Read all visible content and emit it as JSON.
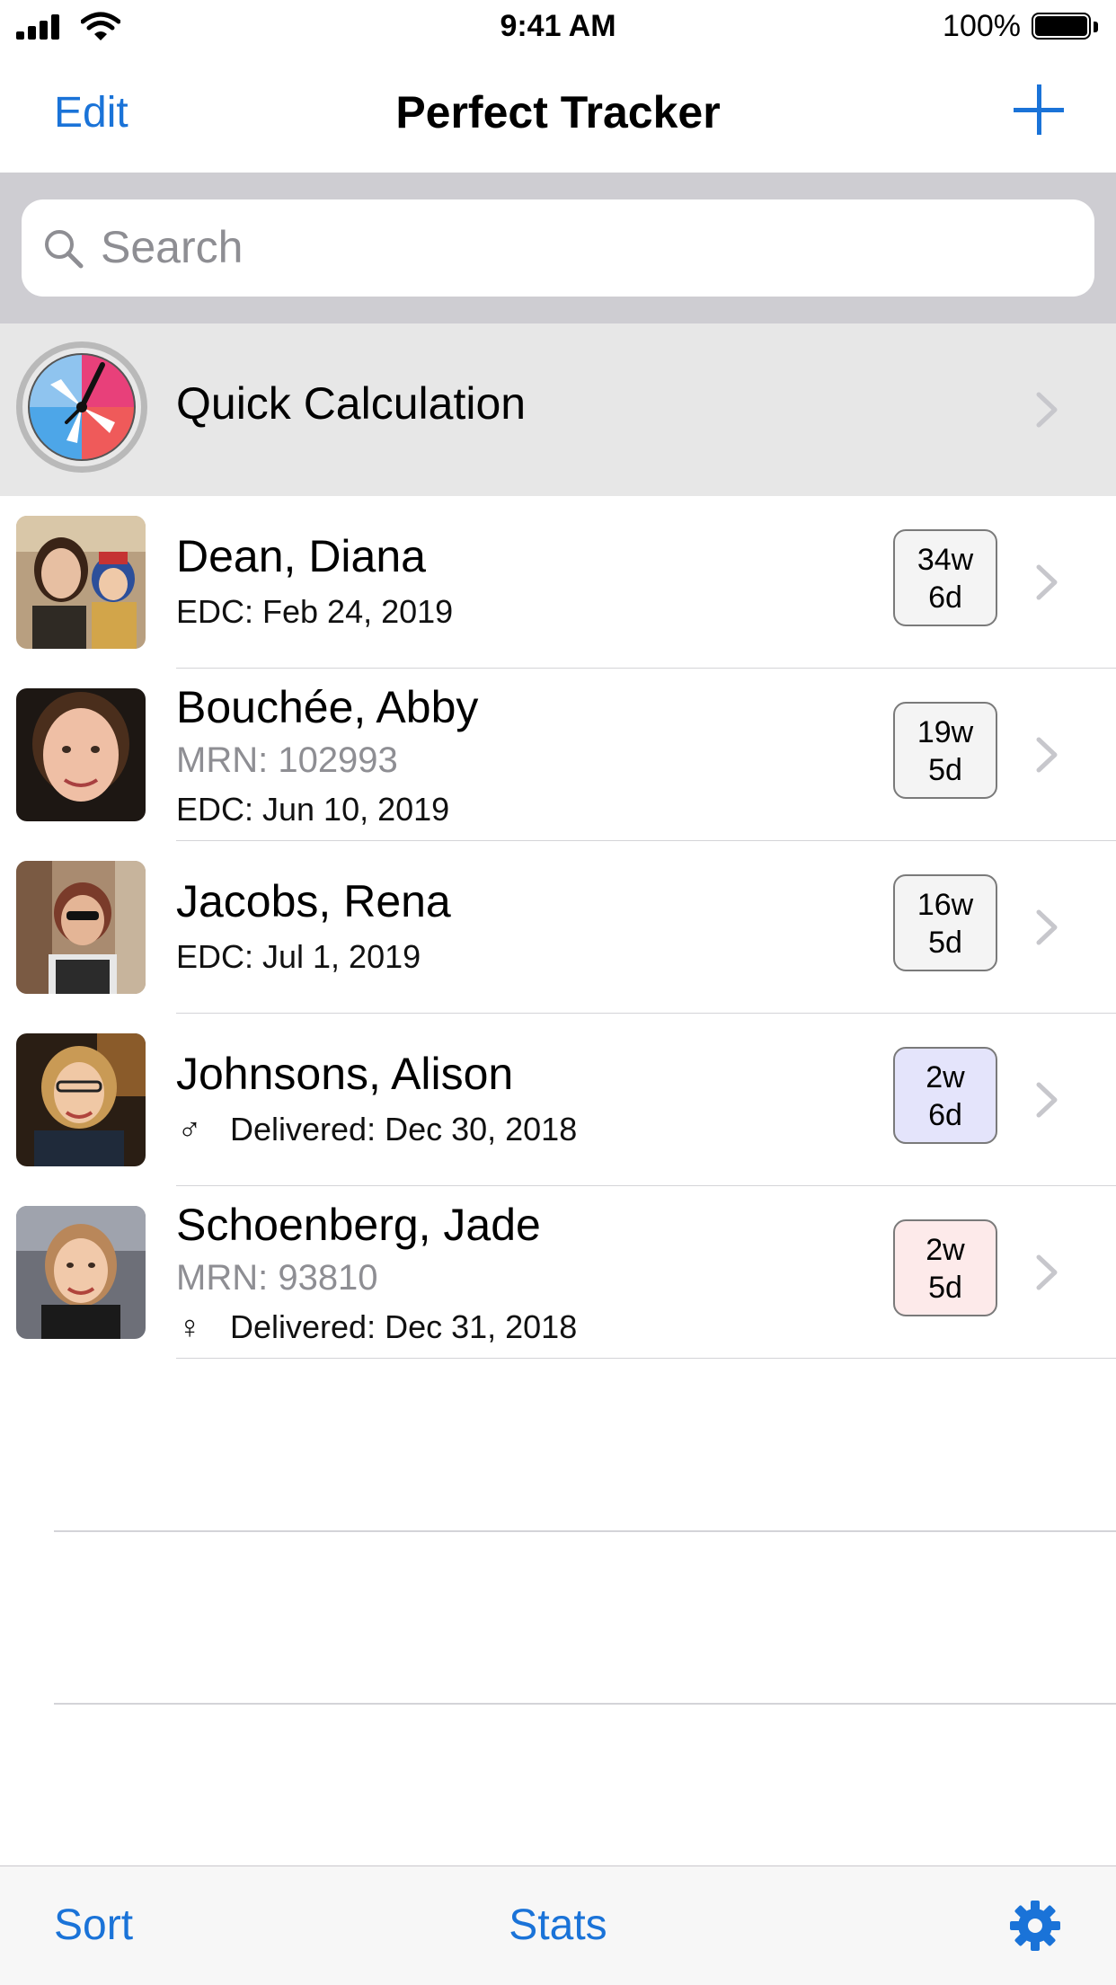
{
  "status_bar": {
    "time": "9:41 AM",
    "battery": "100%"
  },
  "nav": {
    "edit_label": "Edit",
    "title": "Perfect Tracker",
    "add_icon": "plus-icon"
  },
  "search": {
    "placeholder": "Search",
    "value": ""
  },
  "quick": {
    "label": "Quick Calculation"
  },
  "patients": [
    {
      "name": "Dean, Diana",
      "edc": "EDC: Feb 24, 2019",
      "weeks": "34w",
      "days": "6d"
    },
    {
      "name": "Bouchée, Abby",
      "mrn": "MRN: 102993",
      "edc": "EDC: Jun 10, 2019",
      "weeks": "19w",
      "days": "5d"
    },
    {
      "name": "Jacobs, Rena",
      "edc": "EDC: Jul 1, 2019",
      "weeks": "16w",
      "days": "5d"
    },
    {
      "name": "Johnsons, Alison",
      "sex_symbol": "♂",
      "delivered": "Delivered: Dec 30, 2018",
      "weeks": "2w",
      "days": "6d"
    },
    {
      "name": "Schoenberg, Jade",
      "mrn": "MRN: 93810",
      "sex_symbol": "♀",
      "delivered": "Delivered: Dec 31, 2018",
      "weeks": "2w",
      "days": "5d"
    }
  ],
  "toolbar": {
    "sort_label": "Sort",
    "stats_label": "Stats",
    "settings_icon": "gear-icon"
  },
  "colors": {
    "accent": "#1a73d8",
    "badge_default": "#f4f4f4",
    "badge_male": "#e4e4fb",
    "badge_female": "#fdeaea"
  }
}
